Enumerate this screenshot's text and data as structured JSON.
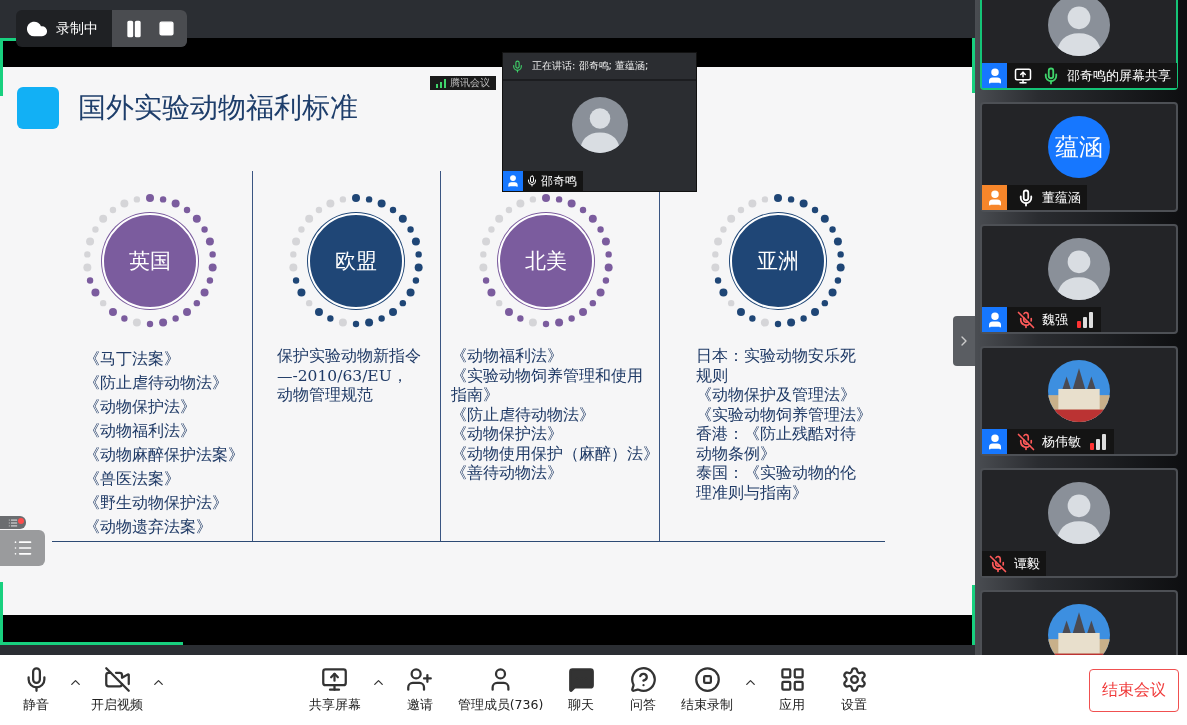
{
  "recording_bar": {
    "label": "录制中"
  },
  "shared_screen": {
    "app_label": "腾讯会议",
    "slide": {
      "title": "国外实验动物福利标准",
      "regions": [
        {
          "name": "英国",
          "color": "#7b5c9e",
          "lines": [
            "《马丁法案》",
            "《防止虐待动物法》",
            "《动物保护法》",
            "《动物福利法》",
            "《动物麻醉保护法案》",
            "《兽医法案》",
            "《野生动物保护法》",
            "《动物遗弃法案》"
          ]
        },
        {
          "name": "欧盟",
          "color": "#1f4676",
          "lines": [
            "保护实验动物新指令",
            "—-2010/63/EU，",
            "动物管理规范"
          ]
        },
        {
          "name": "北美",
          "color": "#7b5c9e",
          "lines": [
            "《动物福利法》",
            "《实验动物饲养管理和使用",
            "指南》",
            "《防止虐待动物法》",
            "《动物保护法》",
            "《动物使用保护（麻醉）法》",
            "《善待动物法》"
          ]
        },
        {
          "name": "亚洲",
          "color": "#1f4676",
          "lines": [
            "日本：实验动物安乐死",
            "规则",
            "《动物保护及管理法》",
            "《实验动物饲养管理法》",
            "香港：《防止残酷对待",
            "动物条例》",
            "泰国：《实验动物的伦",
            "理准则与指南》"
          ]
        }
      ]
    }
  },
  "speaker_window": {
    "speaking_label": "正在讲话: 邵奇鸣; 董蕴涵;",
    "name": "邵奇鸣"
  },
  "participants": [
    {
      "name": "邵奇鸣的屏幕共享",
      "selected": true,
      "color": "#1677ff",
      "sharing": true,
      "muted": false,
      "speaking": true,
      "signal": false,
      "avatar": {
        "kind": "person"
      }
    },
    {
      "name": "董蕴涵",
      "selected": false,
      "color": "#f7862a",
      "sharing": false,
      "muted": false,
      "speaking": false,
      "signal": false,
      "avatar": {
        "kind": "text",
        "text": "蕴涵"
      }
    },
    {
      "name": "魏强",
      "selected": false,
      "color": "#1677ff",
      "sharing": false,
      "muted": true,
      "signal": true,
      "avatar": {
        "kind": "person"
      }
    },
    {
      "name": "杨伟敏",
      "selected": false,
      "color": "#1677ff",
      "sharing": false,
      "muted": true,
      "signal": true
    },
    {
      "name": "谭毅",
      "selected": false,
      "sharing": false,
      "muted": true,
      "signal": false,
      "avatar": {
        "kind": "person"
      }
    },
    {
      "selected": false
    }
  ],
  "toolbar": {
    "left": [
      {
        "label": "静音",
        "caret": true
      },
      {
        "label": "开启视频",
        "caret": true
      }
    ],
    "center": [
      {
        "label": "共享屏幕",
        "caret": true
      },
      {
        "label": "邀请",
        "caret": false
      },
      {
        "label": "管理成员(736)",
        "caret": false
      },
      {
        "label": "聊天",
        "caret": false
      },
      {
        "label": "问答",
        "caret": false
      },
      {
        "label": "结束录制",
        "caret": true
      },
      {
        "label": "应用",
        "caret": false
      },
      {
        "label": "设置",
        "caret": false
      }
    ],
    "end_button": "结束会议"
  }
}
